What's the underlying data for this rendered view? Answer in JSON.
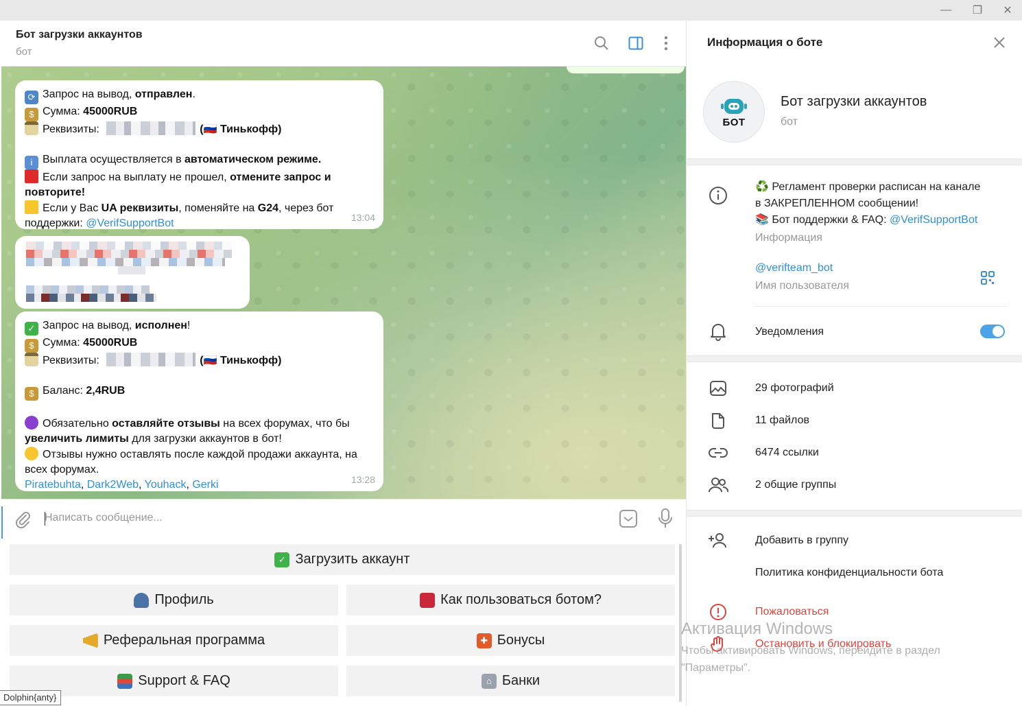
{
  "window": {
    "min": "—",
    "max": "❐",
    "close": "✕"
  },
  "chat": {
    "title": "Бот загрузки аккаунтов",
    "subtitle": "бот"
  },
  "messages": {
    "m1": {
      "l1a": "Запрос на вывод, ",
      "l1b": "отправлен",
      "l1c": ".",
      "l2a": "Сумма: ",
      "l2b": "45000RUB",
      "l3a": "Реквизиты: ",
      "l3b": "(🇷🇺 Тинькофф)",
      "l4a": "Выплата осуществляется в ",
      "l4b": "автоматическом режиме.",
      "l5a": "Если запрос на выплату не прошел, ",
      "l5b": "отмените запрос и",
      "l6": "повторите!",
      "l7a": "Если у Вас ",
      "l7b": "UA реквизиты",
      "l7c": ", поменяйте на ",
      "l7d": "G24",
      "l7e": ", через бот",
      "l8a": "поддержки: ",
      "l8b": "@VerifSupportBot",
      "time": "13:04"
    },
    "m3": {
      "l1a": "Запрос на вывод, ",
      "l1b": "исполнен",
      "l1c": "!",
      "l2a": "Сумма: ",
      "l2b": "45000RUB",
      "l3a": "Реквизиты: ",
      "l3b": "(🇷🇺 Тинькофф)",
      "l4a": "Баланс: ",
      "l4b": "2,4RUB",
      "l5a": "Обязательно ",
      "l5b": "оставляйте отзывы",
      "l5c": " на всех форумах, что бы",
      "l6a": "увеличить лимиты",
      "l6b": " для загрузки аккаунтов в бот!",
      "l7": "Отзывы нужно оставлять после каждой продажи аккаунта, на",
      "l8": "всех форумах.",
      "links": [
        "Piratebuhta",
        "Dark2Web",
        "Youhack",
        "Gerki"
      ],
      "time": "13:28"
    }
  },
  "input": {
    "placeholder": "Написать сообщение..."
  },
  "keyboard": {
    "upload": "Загрузить аккаунт",
    "profile": "Профиль",
    "howto": "Как пользоваться ботом?",
    "referral": "Реферальная программа",
    "bonuses": "Бонусы",
    "support": "Support & FAQ",
    "banks": "Банки"
  },
  "tooltip": "Dolphin{anty}",
  "panel": {
    "title": "Информация о боте",
    "avatar_label": "БОТ",
    "name": "Бот загрузки аккаунтов",
    "kind": "бот",
    "info_line1": "♻️ Регламент проверки расписан на канале",
    "info_line2": "в ЗАКРЕПЛЕННОМ сообщении!",
    "info_line3a": "📚 Бот поддержки & FAQ: ",
    "info_line3b": "@VerifSupportBot",
    "info_caption": "Информация",
    "username": "@verifteam_bot",
    "username_caption": "Имя пользователя",
    "notifications": "Уведомления",
    "notifications_on": true,
    "photos": "29 фотографий",
    "files": "11 файлов",
    "links": "6474 ссылки",
    "groups": "2 общие группы",
    "add_group": "Добавить в группу",
    "privacy": "Политика конфиденциальности бота",
    "report": "Пожаловаться",
    "block": "Остановить и блокировать"
  },
  "watermark": {
    "title": "Активация Windows",
    "line1": "Чтобы активировать Windows, перейдите в раздел",
    "line2": "\"Параметры\"."
  },
  "colors": {
    "accent": "#2f8fd8",
    "danger": "#e0443e",
    "toggle": "#4ca3e6"
  }
}
